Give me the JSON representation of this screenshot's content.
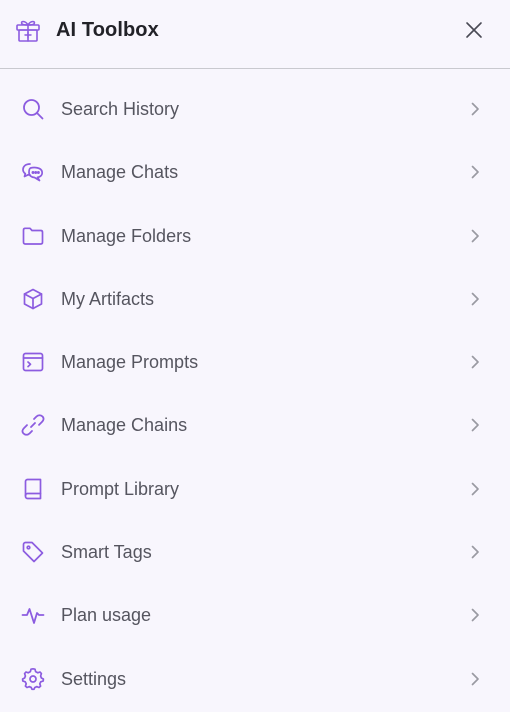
{
  "header": {
    "title": "AI Toolbox",
    "logo_icon": "gift-box-icon",
    "close_icon": "close-icon"
  },
  "colors": {
    "accent": "#8C5CE0",
    "background": "#F8F6FD",
    "text": "#55555F",
    "title": "#222228",
    "chevron": "#9A9AA2",
    "divider": "#C9C9CF"
  },
  "menu": {
    "items": [
      {
        "label": "Search History",
        "icon": "search-icon"
      },
      {
        "label": "Manage Chats",
        "icon": "chat-bubbles-icon"
      },
      {
        "label": "Manage Folders",
        "icon": "folder-icon"
      },
      {
        "label": "My Artifacts",
        "icon": "cube-icon"
      },
      {
        "label": "Manage Prompts",
        "icon": "terminal-window-icon"
      },
      {
        "label": "Manage Chains",
        "icon": "link-icon"
      },
      {
        "label": "Prompt Library",
        "icon": "book-icon"
      },
      {
        "label": "Smart Tags",
        "icon": "tag-icon"
      },
      {
        "label": "Plan usage",
        "icon": "activity-icon"
      },
      {
        "label": "Settings",
        "icon": "gear-icon"
      }
    ]
  }
}
